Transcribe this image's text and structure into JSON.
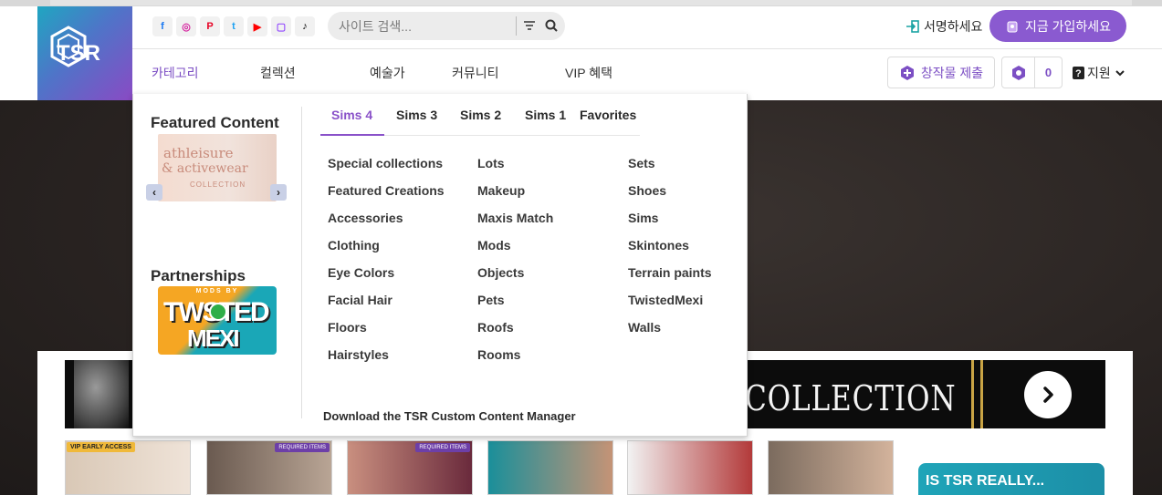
{
  "header": {
    "logo_text": "TSR",
    "search_placeholder": "사이트 검색...",
    "signin_label": "서명하세요",
    "join_label": "지금 가입하세요",
    "submit_label": "창작물 제출",
    "coin_count": "0",
    "support_label": "지원"
  },
  "socials": [
    "facebook-icon",
    "instagram-icon",
    "pinterest-icon",
    "twitter-icon",
    "youtube-icon",
    "twitch-icon",
    "tiktok-icon"
  ],
  "nav": {
    "tabs": [
      {
        "label": "카테고리",
        "active": true
      },
      {
        "label": "컬렉션"
      },
      {
        "label": "예술가"
      },
      {
        "label": "커뮤니티"
      },
      {
        "label": "VIP 혜택"
      }
    ]
  },
  "dropdown": {
    "featured_heading": "Featured Content",
    "featured_card": {
      "line1": "athleisure",
      "line2": "& activewear",
      "line3": "COLLECTION"
    },
    "partnerships_heading": "Partnerships",
    "partner_card": {
      "line0": "MODS BY",
      "line1": "TWSTED",
      "line2": "MEXI"
    },
    "game_tabs": [
      {
        "label": "Sims 4",
        "active": true
      },
      {
        "label": "Sims 3"
      },
      {
        "label": "Sims 2"
      },
      {
        "label": "Sims 1"
      },
      {
        "label": "Favorites"
      }
    ],
    "columns": [
      [
        "Special collections",
        "Featured Creations",
        "Accessories",
        "Clothing",
        "Eye Colors",
        "Facial Hair",
        "Floors",
        "Hairstyles"
      ],
      [
        "Lots",
        "Makeup",
        "Maxis Match",
        "Mods",
        "Objects",
        "Pets",
        "Roofs",
        "Rooms"
      ],
      [
        "Sets",
        "Shoes",
        "Sims",
        "Skintones",
        "Terrain paints",
        "TwistedMexi",
        "Walls"
      ]
    ],
    "cmm_link": "Download the TSR Custom Content Manager"
  },
  "background": {
    "banner_word": "COLLECTION",
    "thumb_vip": "VIP EARLY ACCESS",
    "thumb_required": "REQUIRED ITEMS",
    "promo_text": "IS TSR REALLY..."
  },
  "colors": {
    "accent": "#8a5ad0",
    "active_underline": "#5dc088",
    "logo_start": "#1fa6c1",
    "logo_end": "#8a4ac4"
  }
}
